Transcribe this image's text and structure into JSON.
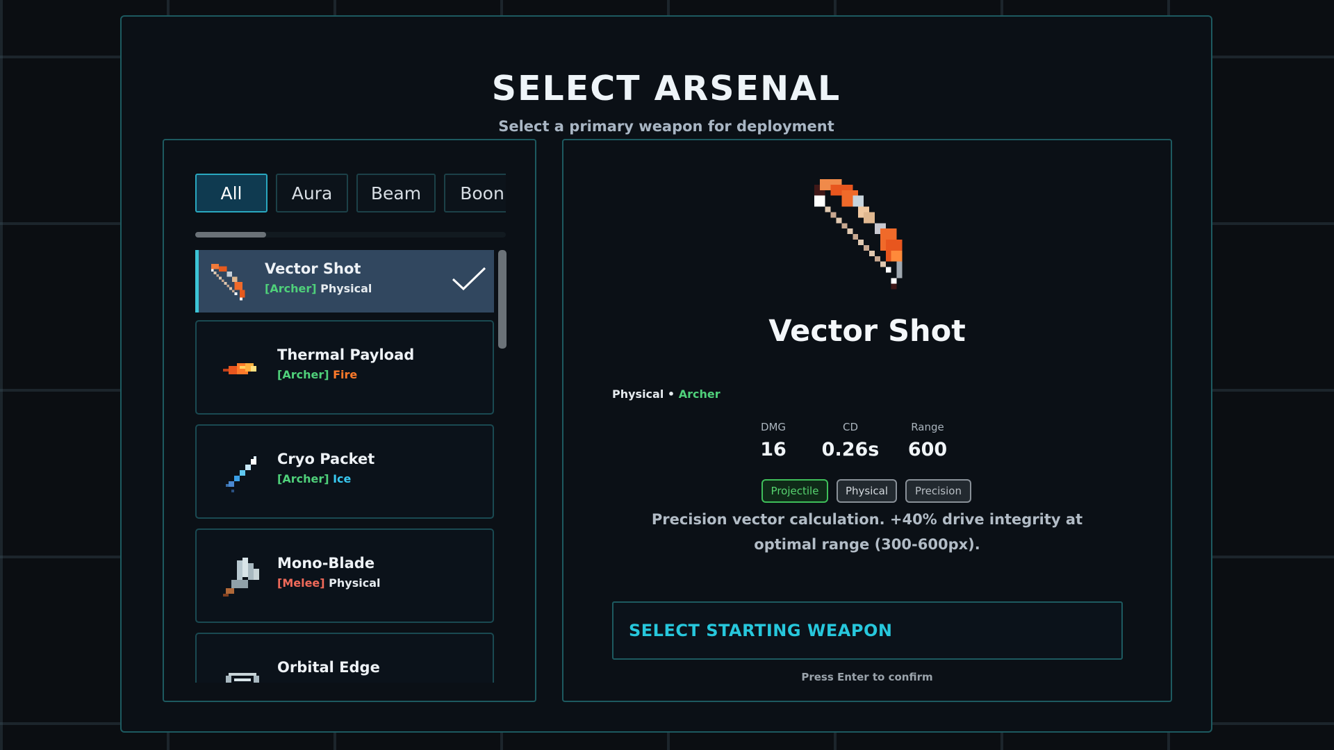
{
  "screen": {
    "title": "SELECT ARSENAL",
    "subtitle": "Select a primary weapon for deployment"
  },
  "tabs": [
    {
      "label": "All",
      "active": true
    },
    {
      "label": "Aura",
      "active": false
    },
    {
      "label": "Beam",
      "active": false
    },
    {
      "label": "Boon",
      "active": false
    }
  ],
  "weapons": [
    {
      "name": "Vector Shot",
      "class_tag": "[Archer]",
      "element": "Physical",
      "icon": "bow-icon",
      "selected": true
    },
    {
      "name": "Thermal Payload",
      "class_tag": "[Archer]",
      "element": "Fire",
      "icon": "fire-arrow-icon",
      "selected": false
    },
    {
      "name": "Cryo Packet",
      "class_tag": "[Archer]",
      "element": "Ice",
      "icon": "ice-arrow-icon",
      "selected": false
    },
    {
      "name": "Mono-Blade",
      "class_tag": "[Melee]",
      "element": "Physical",
      "icon": "blade-icon",
      "selected": false
    },
    {
      "name": "Orbital Edge",
      "class_tag": "",
      "element": "",
      "icon": "orbital-icon",
      "selected": false
    }
  ],
  "detail": {
    "name": "Vector Shot",
    "element": "Physical",
    "separator": "•",
    "class": "Archer",
    "stats": [
      {
        "label": "DMG",
        "value": "16"
      },
      {
        "label": "CD",
        "value": "0.26s"
      },
      {
        "label": "Range",
        "value": "600"
      }
    ],
    "badges": [
      "Projectile",
      "Physical",
      "Precision"
    ],
    "description": "Precision vector calculation. +40% drive integrity at optimal range (300-600px).",
    "select_button": "SELECT STARTING WEAPON",
    "hint": "Press Enter to confirm"
  },
  "colors": {
    "accent": "#27c7dc",
    "archer": "#4fd07a",
    "melee": "#f06a5a",
    "fire": "#ff7a2a",
    "ice": "#38c8f0"
  }
}
